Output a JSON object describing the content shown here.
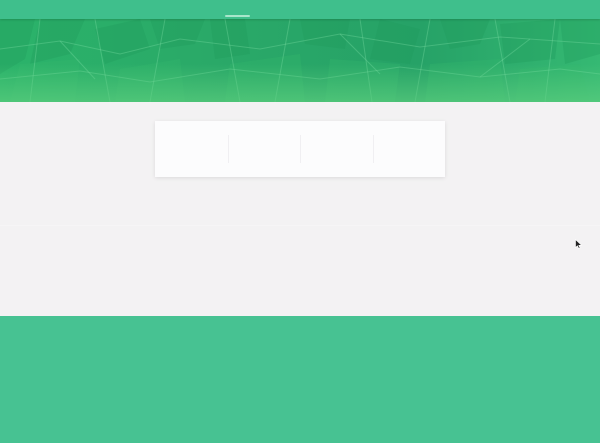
{
  "header": {
    "indicator": "tab-indicator"
  },
  "hero": {
    "background": "aerial-field-pattern",
    "colors": {
      "primary": "#2aa968",
      "light": "#4cc880"
    }
  },
  "stats": [
    {
      "value": "",
      "label": ""
    },
    {
      "value": "",
      "label": ""
    },
    {
      "value": "",
      "label": ""
    },
    {
      "value": "",
      "label": ""
    }
  ],
  "footer": {
    "color": "#47c292"
  },
  "theme": {
    "topbar": "#3fbf8c",
    "page_background": "#f3f2f3",
    "card_background": "#fcfcfd"
  },
  "icons": {
    "cursor": "mouse-pointer-icon"
  }
}
